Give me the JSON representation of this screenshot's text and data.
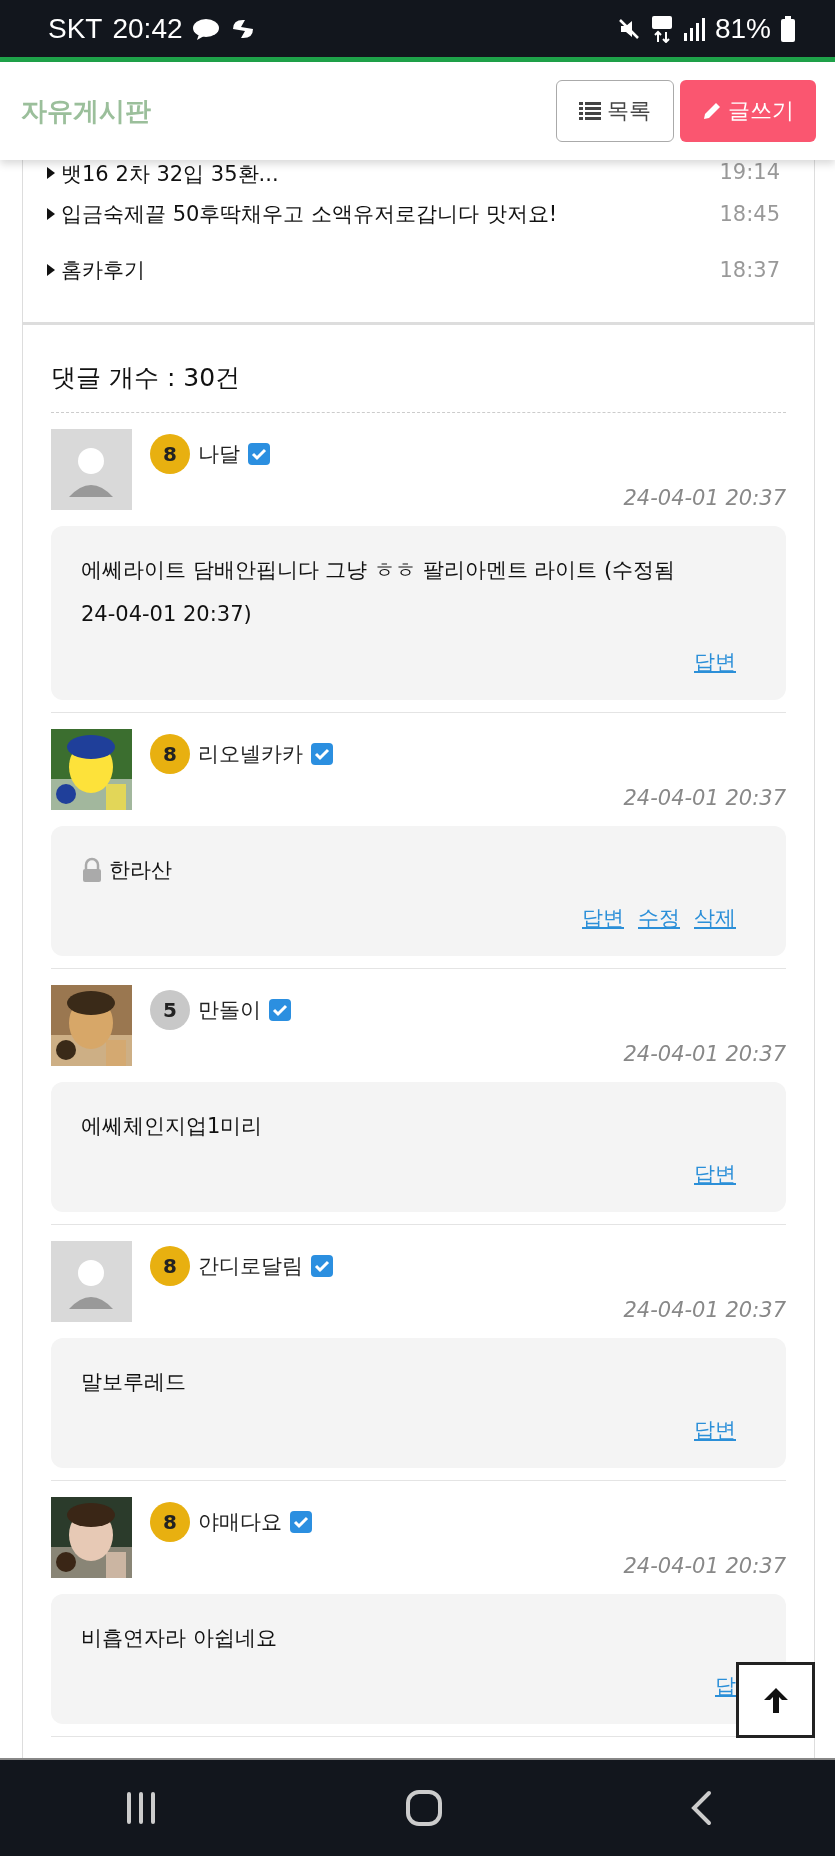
{
  "status_bar": {
    "carrier": "SKT",
    "time": "20:42",
    "battery": "81%"
  },
  "header": {
    "title": "자유게시판",
    "buttons": [
      {
        "kind": "list",
        "label": "목록"
      },
      {
        "kind": "write",
        "label": "글쓰기"
      }
    ]
  },
  "posts": [
    {
      "title": "뱃16 2차 32입 35환...",
      "time": "19:14"
    },
    {
      "title": "입금숙제끝 50후딱채우고 소액유저로갑니다 맛저요!",
      "time": "18:45"
    },
    {
      "title": "홈카후기",
      "time": "18:37"
    }
  ],
  "comments_heading": "댓글 개수 : 30건",
  "comments": [
    {
      "kind": "default",
      "color": "#e8b010",
      "level": "8",
      "name": "나달",
      "date": "24-04-01 20:37",
      "locked": false,
      "text": "에쎄라이트 담배안핍니다 그냥 ㅎㅎ 팔리아멘트 라이트 (수정됨 24-04-01 20:37)",
      "actions": [
        "답변"
      ]
    },
    {
      "kind": "picture",
      "color": "#e8b010",
      "level": "8",
      "name": "리오넬카카",
      "date": "24-04-01 20:37",
      "locked": true,
      "text": "한라산",
      "actions": [
        "답변",
        "수정",
        "삭제"
      ]
    },
    {
      "kind": "picture",
      "color": "#c8c8c8",
      "level": "5",
      "name": "만돌이",
      "date": "24-04-01 20:37",
      "locked": false,
      "text": "에쎄체인지업1미리",
      "actions": [
        "답변"
      ]
    },
    {
      "kind": "default",
      "color": "#e8b010",
      "level": "8",
      "name": "간디로달림",
      "date": "24-04-01 20:37",
      "locked": false,
      "text": "말보루레드",
      "actions": [
        "답변"
      ]
    },
    {
      "kind": "picture",
      "color": "#e8b010",
      "level": "8",
      "name": "야매다요",
      "date": "24-04-01 20:37",
      "locked": false,
      "text": "비흡연자라 아쉽네요",
      "actions": [
        "답"
      ]
    }
  ]
}
